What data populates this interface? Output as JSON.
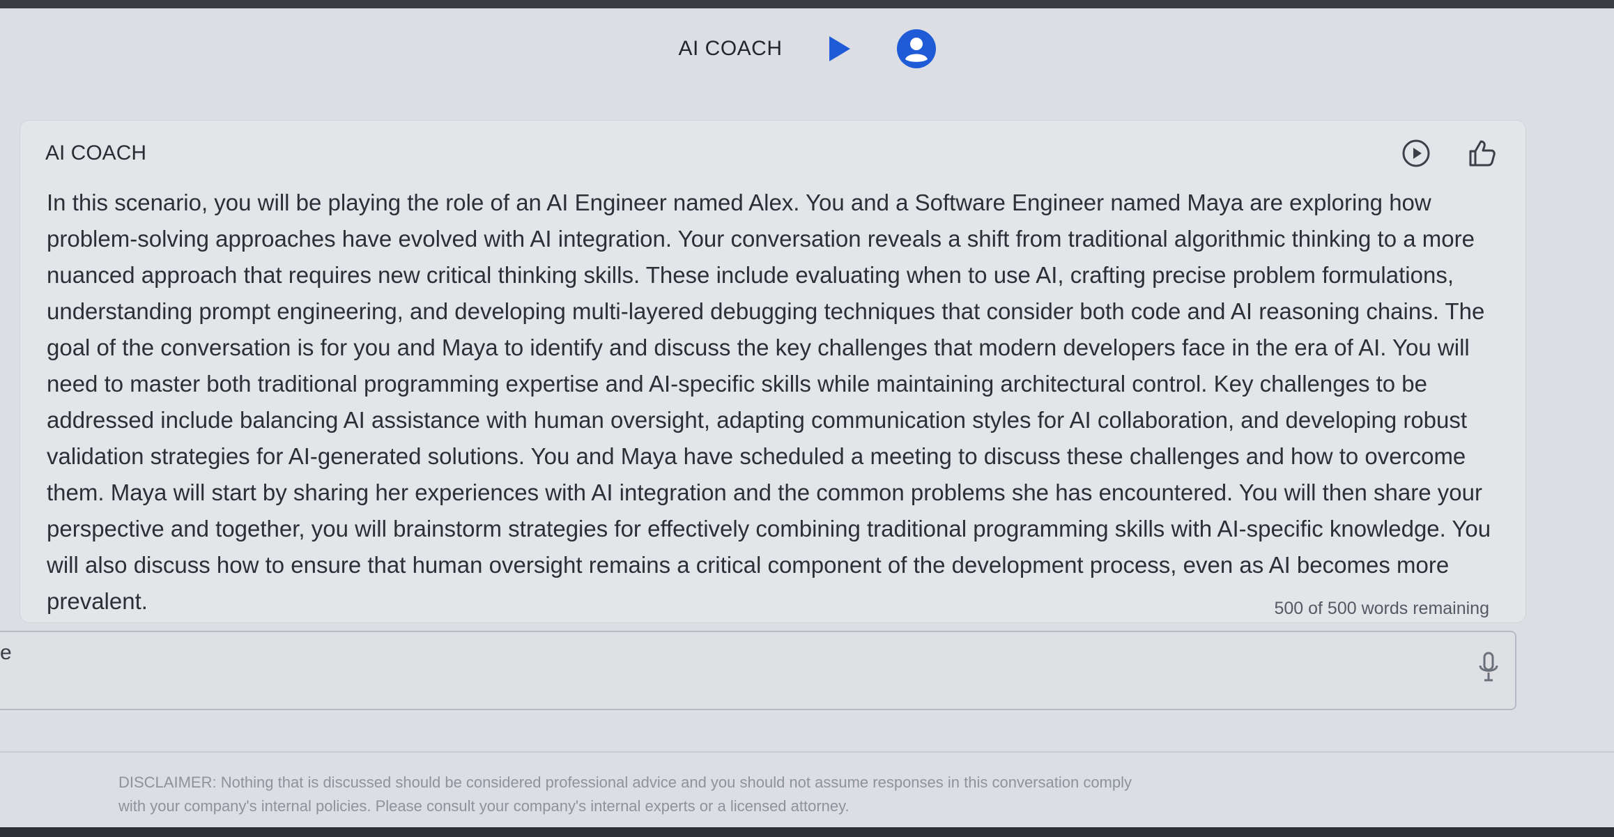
{
  "header": {
    "title": "AI COACH",
    "play_icon": "play-icon",
    "avatar_icon": "user-avatar-icon",
    "accent": "#1f5bd6"
  },
  "card": {
    "label": "AI COACH",
    "replay_icon": "play-circle-icon",
    "like_icon": "thumbs-up-icon",
    "scenario": "In this scenario, you will be playing the role of an AI Engineer named Alex. You and a Software Engineer named Maya are exploring how problem-solving approaches have evolved with AI integration. Your conversation reveals a shift from traditional algorithmic thinking to a more nuanced approach that requires new critical thinking skills. These include evaluating when to use AI, crafting precise problem formulations, understanding prompt engineering, and developing multi-layered debugging techniques that consider both code and AI reasoning chains. The goal of the conversation is for you and Maya to identify and discuss the key challenges that modern developers face in the era of AI. You will need to master both traditional programming expertise and AI-specific skills while maintaining architectural control. Key challenges to be addressed include balancing AI assistance with human oversight, adapting communication styles for AI collaboration, and developing robust validation strategies for AI-generated solutions. You and Maya have scheduled a meeting to discuss these challenges and how to overcome them. Maya will start by sharing her experiences with AI integration and the common problems she has encountered. You will then share your perspective and together, you will brainstorm strategies for effectively combining traditional programming skills with AI-specific knowledge. You will also discuss how to ensure that human oversight remains a critical component of the development process, even as AI becomes more prevalent.",
    "word_count": "500 of 500 words remaining"
  },
  "input": {
    "left_fragment": "e",
    "mic_icon": "microphone-icon"
  },
  "disclaimer": {
    "line1": "DISCLAIMER: Nothing that is discussed should be considered professional advice and you should not assume responses in this conversation comply",
    "line2": "with your company's internal policies. Please consult your company's internal experts or a licensed attorney."
  }
}
